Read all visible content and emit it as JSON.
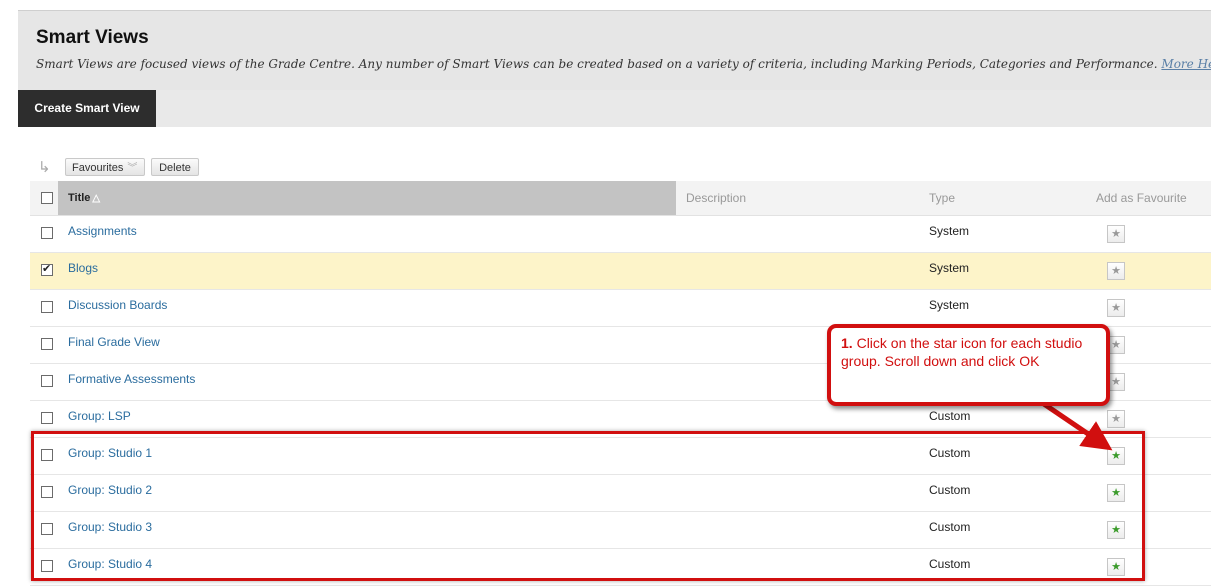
{
  "header": {
    "title": "Smart Views",
    "description": "Smart Views are focused views of the Grade Centre. Any number of Smart Views can be created based on a variety of criteria, including Marking Periods, Categories and Performance.",
    "help_link": "More Help"
  },
  "action_bar": {
    "create_label": "Create Smart View"
  },
  "toolbar": {
    "favourites_label": "Favourites",
    "delete_label": "Delete"
  },
  "table": {
    "columns": [
      "Title",
      "Description",
      "Type",
      "Add as Favourite"
    ],
    "rows": [
      {
        "title": "Assignments",
        "type": "System",
        "checked": false,
        "favourite": false
      },
      {
        "title": "Blogs",
        "type": "System",
        "checked": true,
        "favourite": false
      },
      {
        "title": "Discussion Boards",
        "type": "System",
        "checked": false,
        "favourite": false
      },
      {
        "title": "Final Grade View",
        "type": "",
        "checked": false,
        "favourite": false
      },
      {
        "title": "Formative Assessments",
        "type": "",
        "checked": false,
        "favourite": false
      },
      {
        "title": "Group: LSP",
        "type": "Custom",
        "checked": false,
        "favourite": false
      },
      {
        "title": "Group: Studio 1",
        "type": "Custom",
        "checked": false,
        "favourite": true
      },
      {
        "title": "Group: Studio 2",
        "type": "Custom",
        "checked": false,
        "favourite": true
      },
      {
        "title": "Group: Studio 3",
        "type": "Custom",
        "checked": false,
        "favourite": true
      },
      {
        "title": "Group: Studio 4",
        "type": "Custom",
        "checked": false,
        "favourite": true
      }
    ]
  },
  "callout": {
    "step": "1.",
    "text": "Click on the star icon for each studio group. Scroll down and click OK"
  },
  "colors": {
    "annotation_red": "#d10f0f",
    "link_blue": "#2a6c9e",
    "selected_row": "#fdf4c9",
    "favourite_star": "#3b9b2b"
  }
}
